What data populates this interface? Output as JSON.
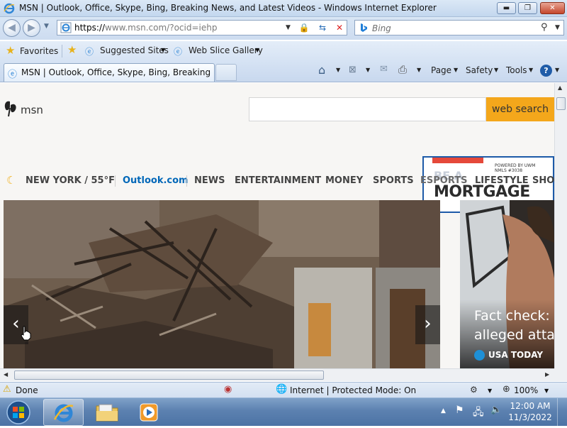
{
  "window": {
    "title": "MSN | Outlook, Office, Skype, Bing, Breaking News, and Latest Videos - Windows Internet Explorer",
    "minimize_icon": "minimize-icon",
    "maximize_icon": "maximize-icon",
    "close_icon": "close-icon"
  },
  "address": {
    "url_prefix": "https://",
    "url_host": "www.msn.com",
    "url_rest": "/?ocid=iehp"
  },
  "search": {
    "placeholder": "Bing"
  },
  "favorites_bar": {
    "favorites_label": "Favorites",
    "items": [
      "Suggested Sites",
      "Web Slice Gallery"
    ]
  },
  "tabs": [
    {
      "label": "MSN | Outlook, Office, Skype, Bing, Breaking Ne..."
    }
  ],
  "command_bar": {
    "page": "Page",
    "safety": "Safety",
    "tools": "Tools"
  },
  "page": {
    "logo_text": "msn",
    "search_button": "web search",
    "weather": "NEW YORK / 55°F",
    "nav": [
      "Outlook.com",
      "NEWS",
      "ENTERTAINMENT",
      "MONEY",
      "SPORTS",
      "ESPORTS",
      "LIFESTYLE",
      "SHO"
    ],
    "ad": {
      "line1": "BE A",
      "line2": "MORTGAGE",
      "powered": "POWERED BY UWM",
      "nmls": "NMLS #3038"
    },
    "hero_next_story": {
      "title_line1": "Fact check: P",
      "title_line2": "alleged attac",
      "source": "USA TODAY"
    },
    "colors": {
      "accent_link": "#0067b8",
      "search_button": "#f4a71b",
      "ad_border": "#1d5aa8"
    }
  },
  "status": {
    "text": "Done",
    "zone": "Internet | Protected Mode: On",
    "zoom": "100%"
  },
  "taskbar": {
    "time": "12:00 AM",
    "date": "11/3/2022"
  }
}
